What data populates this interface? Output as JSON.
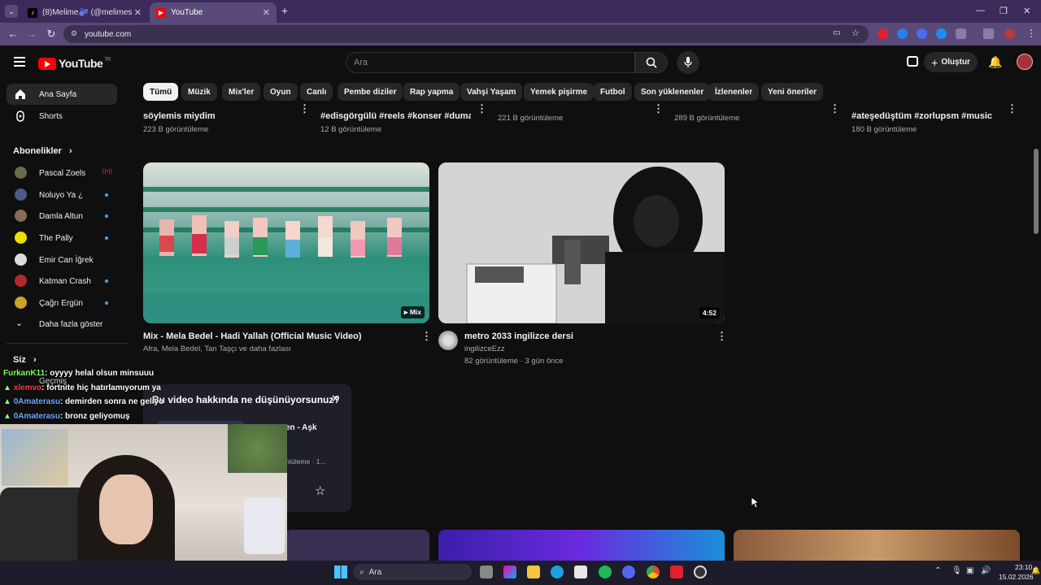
{
  "browser": {
    "tabs": [
      {
        "label": "(8)Melime🫐 (@melimesama) a",
        "active": false
      },
      {
        "label": "YouTube",
        "active": true
      }
    ],
    "new_tab": "+",
    "url": "youtube.com"
  },
  "youtube": {
    "logo_text": "YouTube",
    "logo_region": "TR",
    "search_placeholder": "Ara",
    "create_label": "Oluştur",
    "chips": [
      "Tümü",
      "Müzik",
      "Mix'ler",
      "Oyun",
      "Canlı",
      "Pembe diziler",
      "Rap yapma",
      "Vahşi Yaşam",
      "Yemek pişirme",
      "Futbol",
      "Son yüklenenler",
      "İzlenenler",
      "Yeni öneriler"
    ],
    "sidebar": {
      "home": "Ana Sayfa",
      "shorts": "Shorts",
      "subscriptions_header": "Abonelikler",
      "subscriptions": [
        {
          "name": "Pascal Zoels",
          "live": true
        },
        {
          "name": "Noluyo Ya ¿",
          "dot": true
        },
        {
          "name": "Damla Altun",
          "dot": true
        },
        {
          "name": "The Pally",
          "dot": true
        },
        {
          "name": "Emir Can İğrek",
          "dot": false
        },
        {
          "name": "Katman Crash",
          "dot": true
        },
        {
          "name": "Çağrı Ergün",
          "dot": true
        }
      ],
      "show_more": "Daha fazla göster",
      "you_header": "Siz",
      "history": "Geçmiş"
    },
    "top_row": [
      {
        "title": "söylemis miydim",
        "meta": "223 B görüntüleme"
      },
      {
        "title": "#edisgörgülü #reels #konser #duma...",
        "meta": "12 B görüntüleme"
      },
      {
        "title": "",
        "meta": "221 B görüntüleme"
      },
      {
        "title": "",
        "meta": "289 B görüntüleme"
      },
      {
        "title": "#ateşedüştüm #zorlupsm #music ...",
        "meta": "180 B görüntüleme"
      }
    ],
    "videos": [
      {
        "title": "Mix - Mela Bedel - Hadi Yallah (Official Music Video)",
        "channel": "Afra, Mela Bedel, Tan Taşçı ve daha fazlası",
        "badge": "Mix"
      },
      {
        "title": "metro 2033 ingilizce dersi",
        "channel": "ingilizceEzz",
        "meta": "82 görüntüleme · 3 gün önce",
        "duration": "4:52"
      }
    ],
    "feedback": {
      "question": "Bu video hakkında ne düşünüyorsunuz?",
      "partial_title": "en - Aşk",
      "partial_meta": "ntüleme · 1..."
    }
  },
  "chat_overlay": [
    {
      "user": "FurkanK11",
      "user_color": "#7cfc5a",
      "text": ": oyyyy helal olsun minsuuu"
    },
    {
      "user": "xlemvo",
      "user_color": "#ff3b3b",
      "text": ": fortnite hiç hatırlamıyorum ya"
    },
    {
      "user": "0Amaterasu",
      "user_color": "#6fa8ff",
      "text": ": demirden sonra ne geliyo"
    },
    {
      "user": "0Amaterasu",
      "user_color": "#6fa8ff",
      "text": ": bronz geliyomuş"
    }
  ],
  "taskbar": {
    "search": "Ara",
    "time": "23:10",
    "date": "15.02.2026"
  }
}
